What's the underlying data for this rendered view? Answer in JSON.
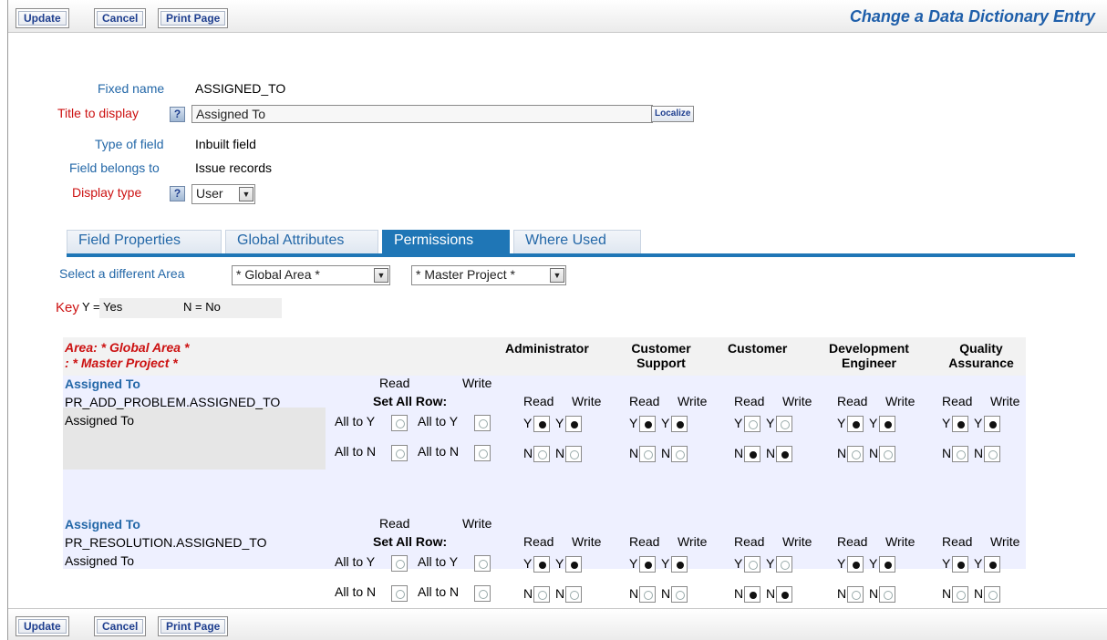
{
  "toolbar": {
    "update": "Update",
    "cancel": "Cancel",
    "print": "Print Page"
  },
  "page_title": "Change a Data Dictionary Entry",
  "form": {
    "fixed_name_label": "Fixed name",
    "fixed_name_value": "ASSIGNED_TO",
    "title_label": "Title to display",
    "title_value": "Assigned To",
    "localize": "Localize",
    "type_label": "Type of field",
    "type_value": "Inbuilt field",
    "belongs_label": "Field belongs to",
    "belongs_value": "Issue records",
    "display_label": "Display type",
    "display_value": "User",
    "help": "?"
  },
  "tabs": [
    "Field Properties",
    "Global Attributes",
    "Permissions",
    "Where Used"
  ],
  "active_tab": "Permissions",
  "area": {
    "label": "Select a different Area",
    "area_value": "* Global Area *",
    "project_value": "* Master Project *"
  },
  "key": {
    "label": "Key",
    "yes": "Y = Yes",
    "no": "N = No"
  },
  "perm": {
    "area_line1": "Area: * Global Area *",
    "area_line2": ": * Master Project *",
    "roles": [
      {
        "line1": "Administrator",
        "line2": ""
      },
      {
        "line1": "Customer",
        "line2": "Support"
      },
      {
        "line1": "Customer",
        "line2": ""
      },
      {
        "line1": "Development",
        "line2": "Engineer"
      },
      {
        "line1": "Quality",
        "line2": "Assurance"
      }
    ],
    "read": "Read",
    "write": "Write",
    "set_all": "Set All Row:",
    "all_y": "All to Y",
    "all_n": "All to N",
    "y": "Y",
    "n": "N",
    "rows": [
      {
        "title": "Assigned To",
        "db_name": "PR_ADD_PROBLEM.ASSIGNED_TO",
        "display": "Assigned To",
        "read_yes": [
          true,
          true,
          false,
          true,
          true
        ],
        "write_yes": [
          true,
          true,
          false,
          true,
          true
        ]
      },
      {
        "title": "Assigned To",
        "db_name": "PR_RESOLUTION.ASSIGNED_TO",
        "display": "Assigned To",
        "read_yes": [
          true,
          true,
          false,
          true,
          true
        ],
        "write_yes": [
          true,
          true,
          false,
          true,
          true
        ]
      }
    ]
  }
}
